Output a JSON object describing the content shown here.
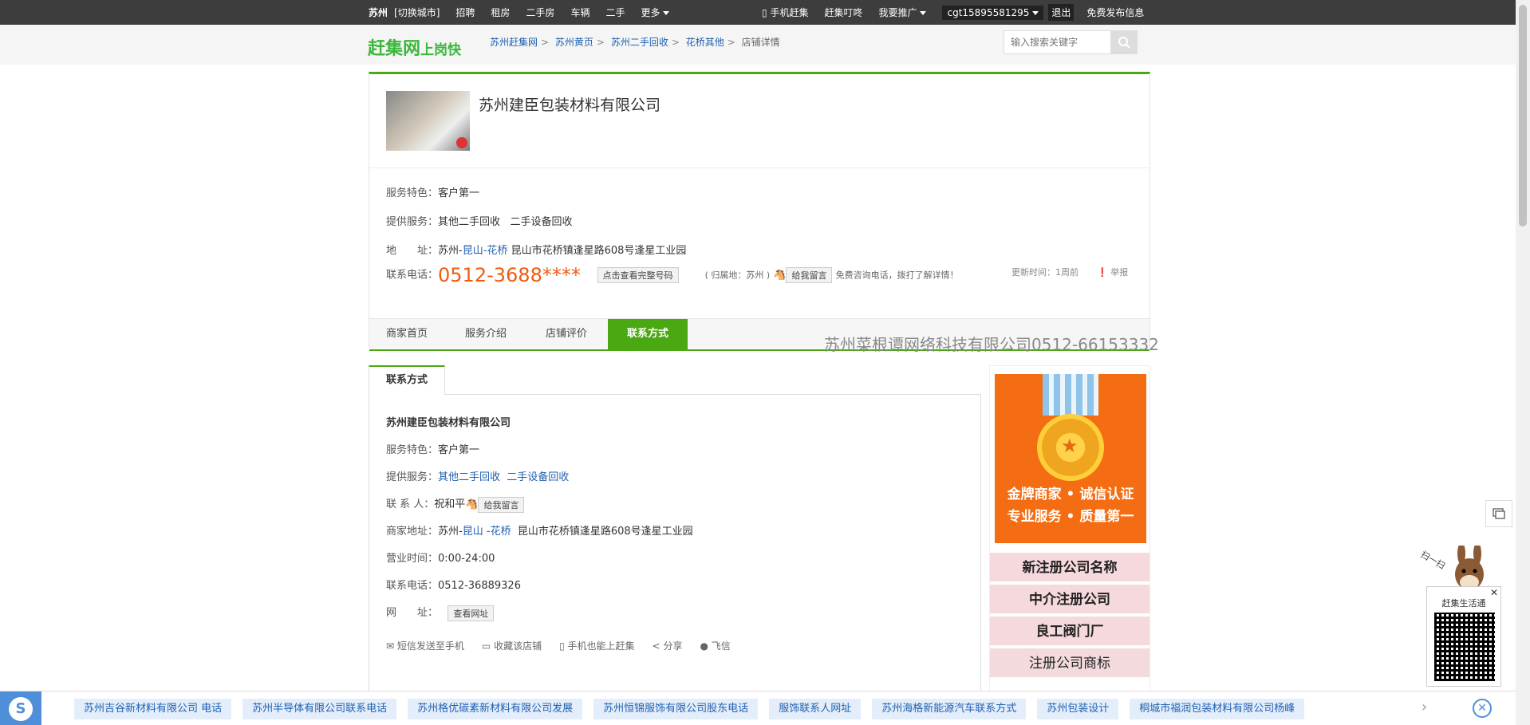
{
  "topnav": {
    "city": "苏州",
    "switch_city": "[切换城市]",
    "items": [
      "招聘",
      "租房",
      "二手房",
      "车辆",
      "二手",
      "更多"
    ],
    "mobile": "手机赶集",
    "dingdong": "赶集叮咚",
    "promote": "我要推广",
    "username": "cgt15895581295",
    "logout": "退出",
    "publish": "免费发布信息"
  },
  "header": {
    "logo_main": "赶集网",
    "logo_sub": "上岗快",
    "breadcrumbs": [
      "苏州赶集网",
      "苏州黄页",
      "苏州二手回收",
      "花桥其他"
    ],
    "breadcrumb_current": "店铺详情",
    "search_placeholder": "输入搜索关键字"
  },
  "shop": {
    "name": "苏州建臣包装材料有限公司",
    "feature_label": "服务特色：",
    "feature": "客户第一",
    "service_label": "提供服务：",
    "services": [
      "其他二手回收",
      "二手设备回收"
    ],
    "address_label": "地　　址：",
    "address_city": "苏州-",
    "address_district": "昆山-花桥",
    "address_street": "昆山市花桥镇逢星路608号逢星工业园",
    "phone_label": "联系电话：",
    "phone_masked": "0512-3688****",
    "view_full_button": "点击查看完整号码",
    "attribution": "( 归属地：苏州 )",
    "message_button": "给我留言",
    "free_call_note": "免费咨询电话，拨打了解详情！",
    "updated": "更新时间：1周前",
    "report": "举报"
  },
  "tabs": [
    "商家首页",
    "服务介绍",
    "店铺评价",
    "联系方式"
  ],
  "active_tab": "联系方式",
  "watermark": "苏州菜根谭网络科技有限公司0512-66153332",
  "contact": {
    "tab": "联系方式",
    "company": "苏州建臣包装材料有限公司",
    "feature_label": "服务特色：",
    "feature": "客户第一",
    "service_label": "提供服务：",
    "services": [
      "其他二手回收",
      "二手设备回收"
    ],
    "person_label": "联 系 人：",
    "person": "祝和平",
    "message_button": "给我留言",
    "address_label": "商家地址：",
    "address_city": "苏州-",
    "address_district1": "昆山",
    "address_district2": "-花桥",
    "address_street": "昆山市花桥镇逢星路608号逢星工业园",
    "hours_label": "营业时间：",
    "hours": "0:00-24:00",
    "phone_label": "联系电话：",
    "phone": "0512-36889326",
    "site_label": "网　　址：",
    "site_button": "查看网址",
    "actions": [
      "短信发送至手机",
      "收藏该店铺",
      "手机也能上赶集",
      "分享",
      "飞信"
    ]
  },
  "ad": {
    "slogan1": "金牌商家 • 诚信认证",
    "slogan2": "专业服务 • 质量第一",
    "links": [
      "新注册公司名称",
      "中介注册公司",
      "良工阀门厂",
      "注册公司商标"
    ]
  },
  "qr": {
    "title": "赶集生活通",
    "scan": "扫一扫"
  },
  "bottom_chips": [
    "苏州吉谷新材料有限公司 电话",
    "苏州半导体有限公司联系电话",
    "苏州格优碳素新材料有限公司发展",
    "苏州恒锦服饰有限公司股东电话",
    "服饰联系人网址",
    "苏州海格新能源汽车联系方式",
    "苏州包装设计",
    "桐城市福润包装材料有限公司杨峰"
  ]
}
